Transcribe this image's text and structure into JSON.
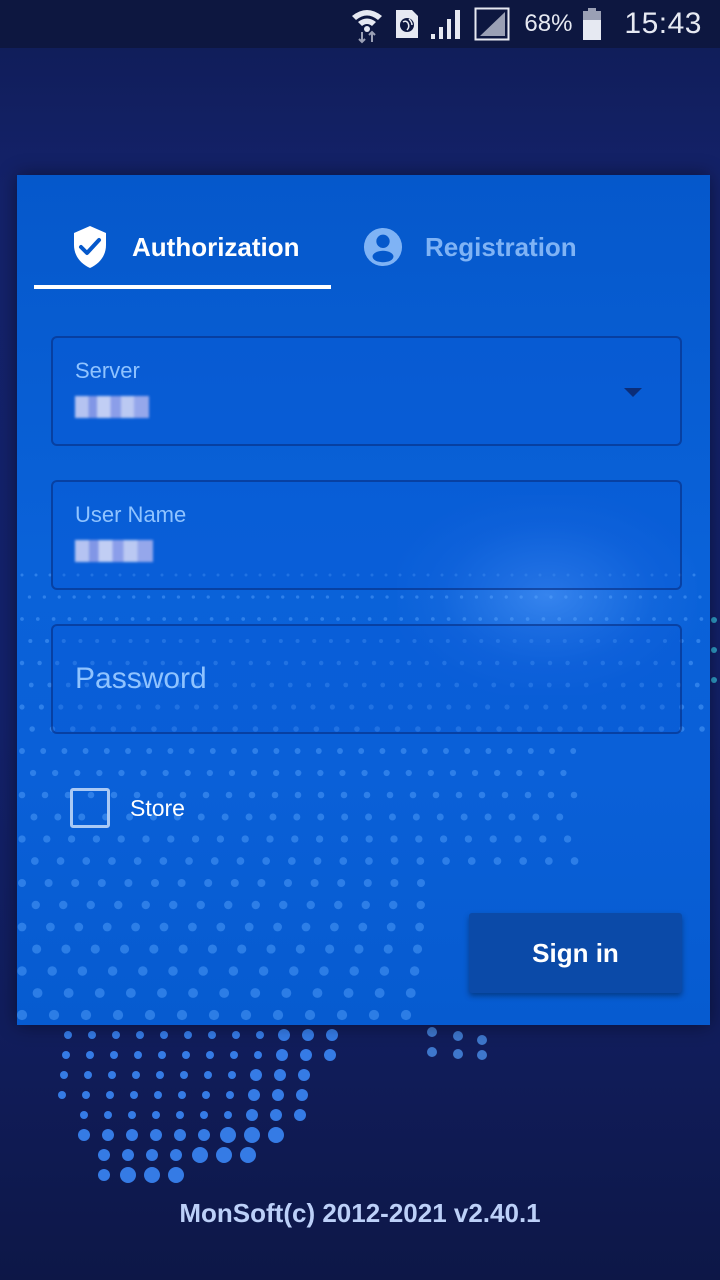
{
  "status_bar": {
    "icons": [
      "wifi-data-icon",
      "sim-globe-icon",
      "cell-signal-icon",
      "no-signal-icon"
    ],
    "battery_percent": "68%",
    "battery_level": 0.68,
    "time": "15:43"
  },
  "tabs": [
    {
      "label": "Authorization",
      "icon": "shield-check-icon",
      "active": true
    },
    {
      "label": "Registration",
      "icon": "account-circle-icon",
      "active": false
    }
  ],
  "form": {
    "server": {
      "label": "Server",
      "value": "[redacted]"
    },
    "username": {
      "label": "User Name",
      "value": "[redacted]"
    },
    "password": {
      "placeholder": "Password",
      "value": ""
    },
    "store": {
      "label": "Store",
      "checked": false
    },
    "signin_label": "Sign in"
  },
  "colors": {
    "card": "#0a60d8",
    "active_tab_text": "#ffffff",
    "inactive_tab_text": "#7fb3f5",
    "field_label": "#8fc3ff",
    "button": "#0b4aa8",
    "background": "#13216a"
  },
  "footer": {
    "copyright": "MonSoft(c) 2012-2021 v2.40.1"
  }
}
